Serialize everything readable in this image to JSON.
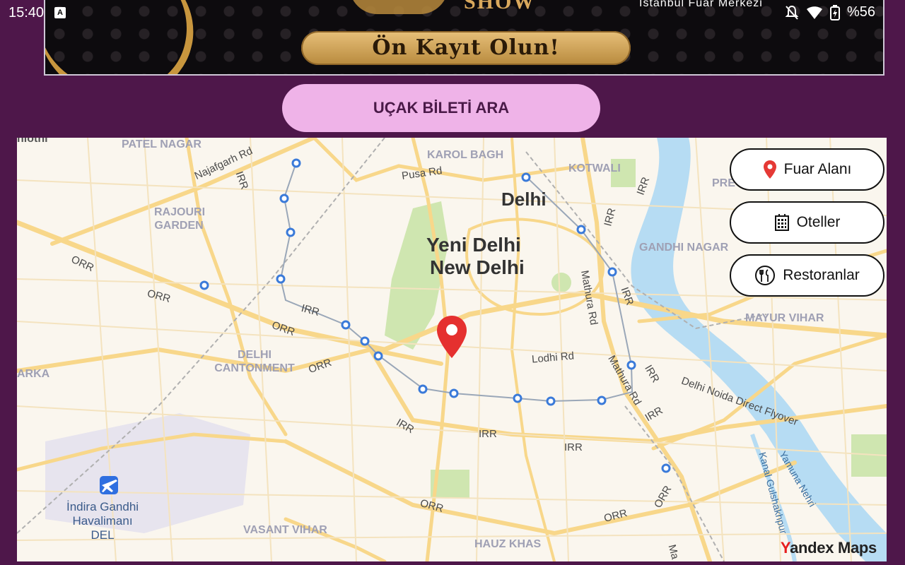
{
  "status_bar": {
    "time": "15:40",
    "battery": "%56",
    "icons": [
      "font-app-icon",
      "bell-muted-icon",
      "wifi-icon",
      "battery-charging-icon"
    ]
  },
  "banner": {
    "show_text": "SHOW",
    "venue_text": "İstanbul Fuar Merkezi",
    "cta_text": "Ön Kayıt Olun!"
  },
  "flight_button": {
    "label": "UÇAK BİLETİ ARA"
  },
  "map": {
    "provider_label": "Yandex Maps",
    "provider_first_letter": "Y",
    "provider_rest": "andex Maps",
    "pin_icon": "location-pin-icon",
    "buttons": [
      {
        "label": "Fuar Alanı",
        "icon": "location-pin-icon",
        "color": "#e53935"
      },
      {
        "label": "Oteller",
        "icon": "hotel-building-icon"
      },
      {
        "label": "Restoranlar",
        "icon": "fork-knife-icon"
      }
    ],
    "districts": [
      "PATEL NAGAR",
      "KAROL BAGH",
      "KOTWALI",
      "RAJOURI GARDEN",
      "GANDHI NAGAR",
      "MAYUR VIHAR",
      "DELHI CANTONMENT",
      "VASANT VIHAR",
      "HAUZ KHAS",
      "ARKA",
      "PRE",
      "nlothi"
    ],
    "cities": {
      "delhi": "Delhi",
      "new_delhi_tr": "Yeni Delhi",
      "new_delhi_en": "New Delhi"
    },
    "roads": [
      "Najafgarh Rd",
      "Pusa Rd",
      "IRR",
      "ORR",
      "Mathura Rd",
      "Lodhi Rd",
      "Delhi Noida Direct Flyover",
      "Yamuna Nehri",
      "Kanal Gulshakhpur",
      "Ma"
    ],
    "airport": {
      "name": "İndira Gandhi",
      "name2": "Havalimanı",
      "code": "DEL"
    }
  },
  "colors": {
    "background": "#4e174a",
    "flight_button_bg": "#efb3e8",
    "map_road": "#f9d98c",
    "river": "#a9d7f2",
    "park": "#c9e3a3"
  }
}
